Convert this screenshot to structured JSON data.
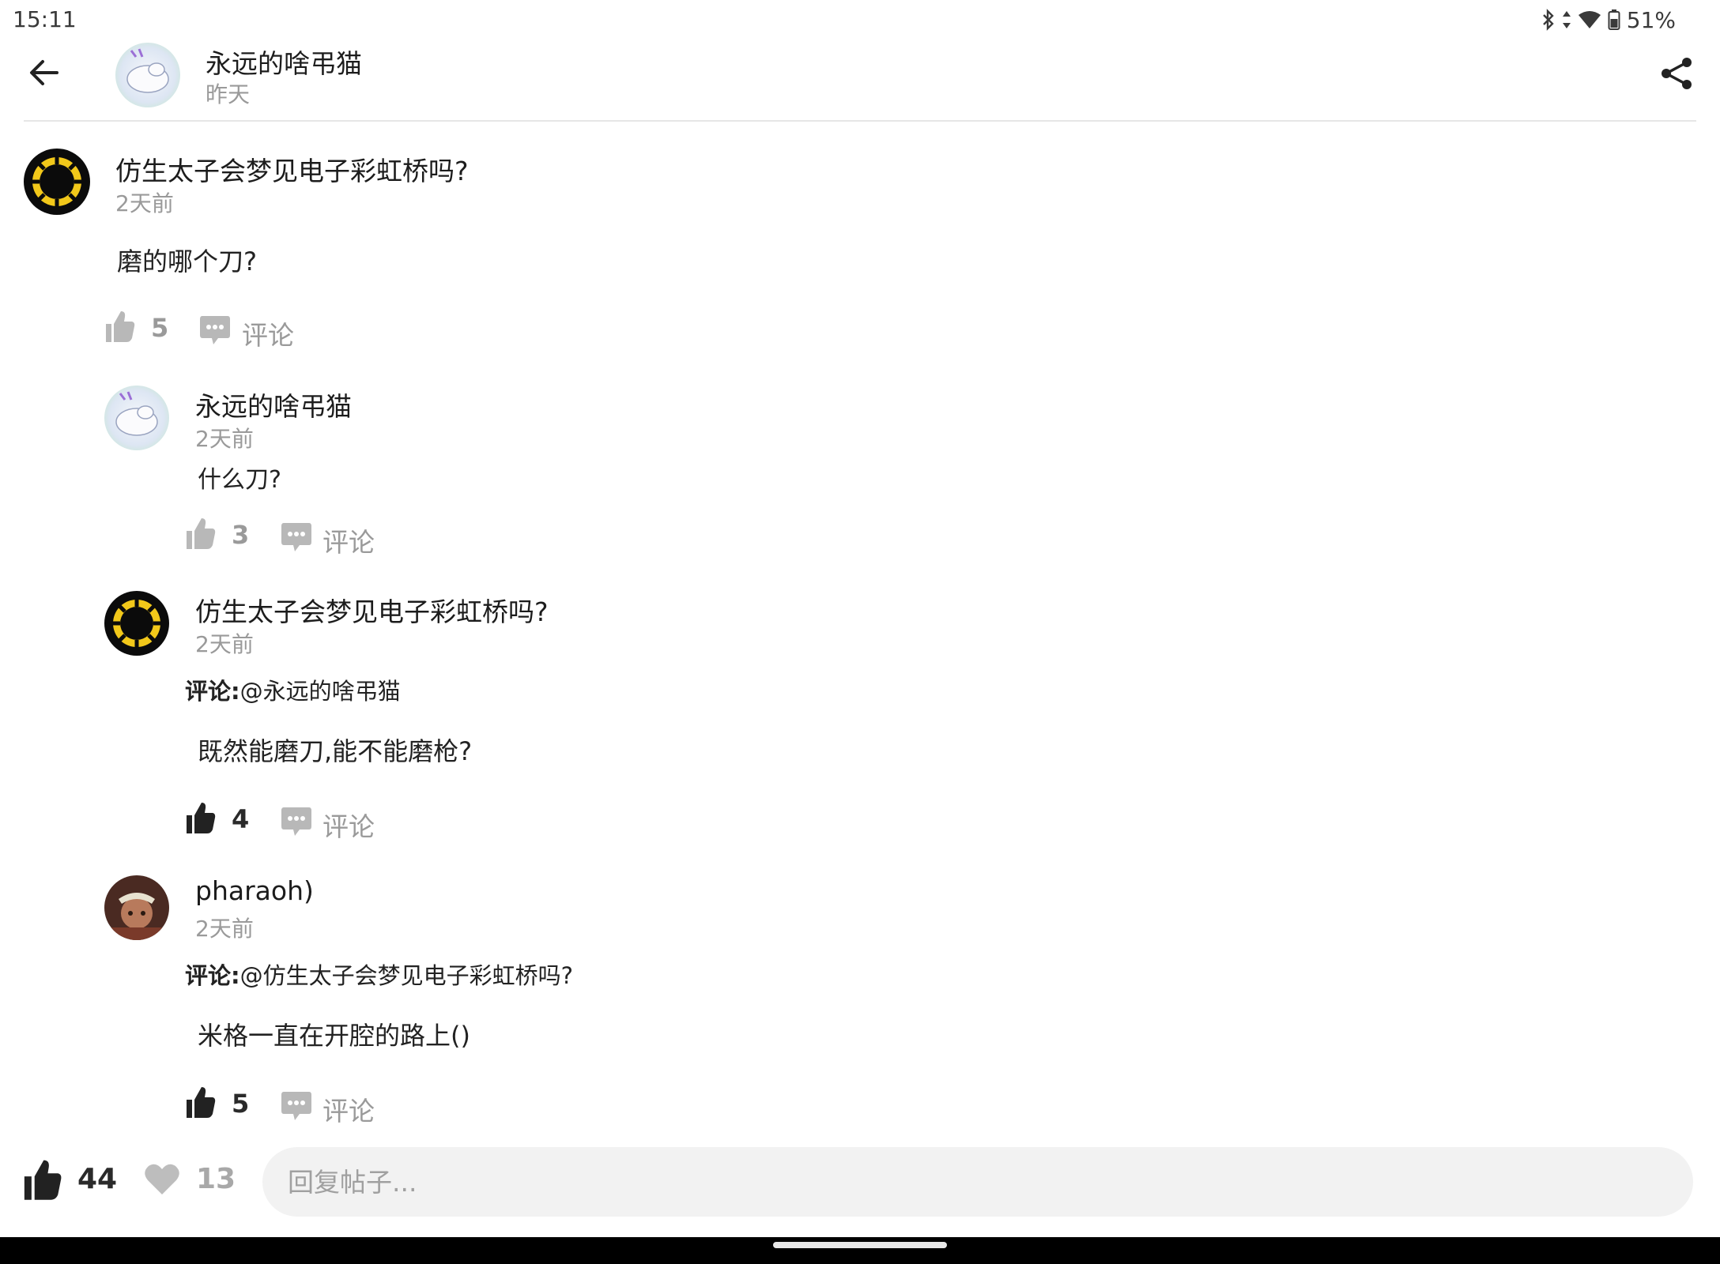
{
  "status_bar": {
    "time": "15:11",
    "battery": "51%"
  },
  "header": {
    "author": "永远的啥弔猫",
    "time": "昨天"
  },
  "main_comment": {
    "author": "仿生太子会梦见电子彩虹桥吗?",
    "time": "2天前",
    "content": "磨的哪个刀?",
    "likes": "5",
    "comment_label": "评论"
  },
  "replies": [
    {
      "author": "永远的啥弔猫",
      "time": "2天前",
      "content": "什么刀?",
      "likes": "3",
      "liked": false,
      "comment_label": "评论"
    },
    {
      "author": "仿生太子会梦见电子彩虹桥吗?",
      "time": "2天前",
      "reply_label": "评论:",
      "reply_target": "@永远的啥弔猫",
      "content": "既然能磨刀,能不能磨枪?",
      "likes": "4",
      "liked": true,
      "comment_label": "评论"
    },
    {
      "author": "pharaoh)",
      "time": "2天前",
      "reply_label": "评论:",
      "reply_target": "@仿生太子会梦见电子彩虹桥吗?",
      "content": "米格一直在开腔的路上()",
      "likes": "5",
      "liked": true,
      "comment_label": "评论"
    }
  ],
  "bottom_bar": {
    "likes": "44",
    "favorites": "13",
    "reply_placeholder": "回复帖子..."
  },
  "icons": {
    "back": "arrow-left-icon",
    "share": "share-icon",
    "like": "thumbs-up-icon",
    "comment": "comment-bubble-icon",
    "favorite": "heart-icon"
  },
  "colors": {
    "muted": "#9a9a9a",
    "liked": "#222222",
    "input_bg": "#f2f2f2"
  }
}
